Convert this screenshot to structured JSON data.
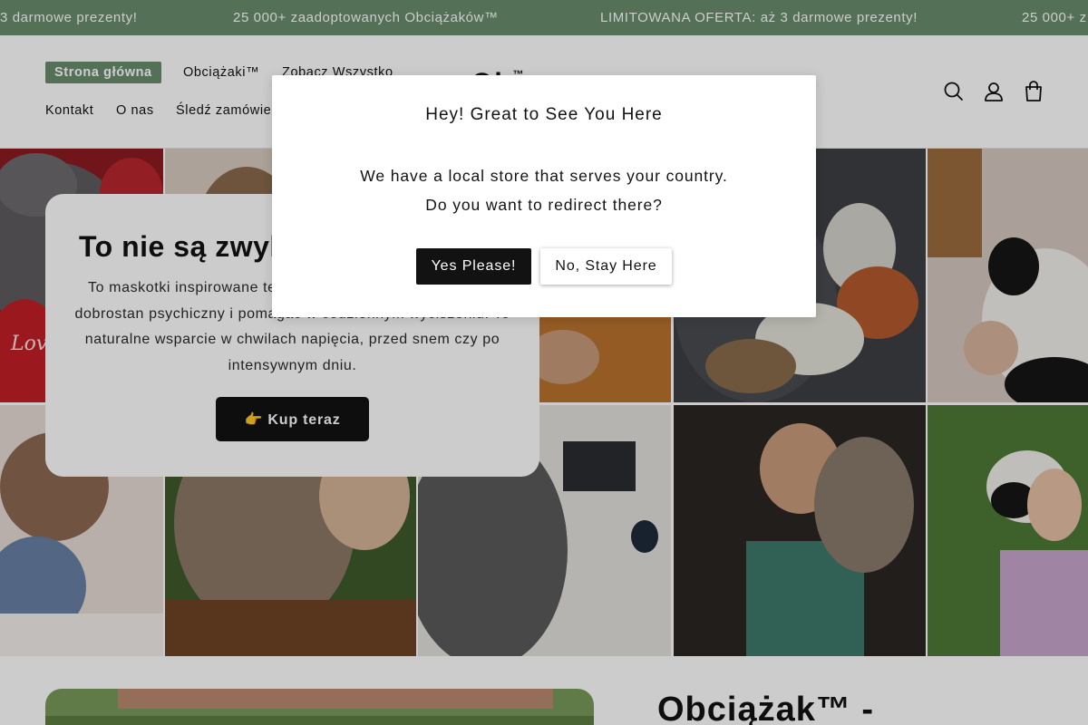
{
  "announcement": {
    "messages": [
      "3 darmowe prezenty!",
      "25 000+ zaadoptowanych Obciążaków™",
      "LIMITOWANA OFERTA: aż 3 darmowe prezenty!",
      "25 000+ z"
    ],
    "background": "#6a8c6c"
  },
  "header": {
    "nav": [
      {
        "label": "Strona główna",
        "active": true
      },
      {
        "label": "Obciążaki™"
      },
      {
        "label": "Zobacz Wszystko"
      },
      {
        "label": "Kontakt"
      },
      {
        "label": "O nas"
      },
      {
        "label": "Śledź zamówie"
      }
    ],
    "logo": {
      "text": "Ob",
      "mark": "™"
    },
    "icons": [
      "search-icon",
      "account-icon",
      "cart-icon"
    ],
    "accent": "#6a8c6c"
  },
  "hero": {
    "heading": "To nie są zwyk",
    "body": "To maskotki inspirowane te... stworzone po to, by wspierać dobrostan psychiczny i pomagać w codziennym wyciszeniu. To naturalne wsparcie w chwilach napięcia, przed snem czy po intensywnym dniu.",
    "cta": "👉 Kup teraz"
  },
  "below": {
    "title": "Obciążak™ -"
  },
  "modal": {
    "title": "Hey! Great to See You Here",
    "line1": "We have a local store that serves your country.",
    "line2": "Do you want to redirect there?",
    "yes": "Yes Please!",
    "no": "No, Stay Here"
  }
}
